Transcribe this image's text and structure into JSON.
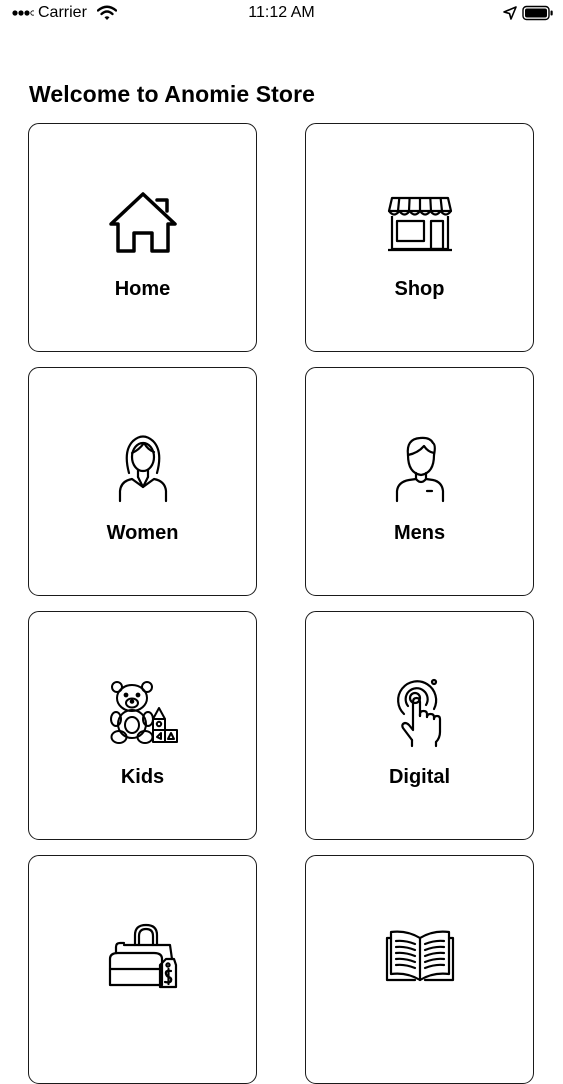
{
  "status_bar": {
    "carrier": "Carrier",
    "time": "11:12 AM",
    "signal_icon": "signal-dots-icon",
    "wifi_icon": "wifi-icon",
    "location_icon": "location-arrow-icon",
    "battery_icon": "battery-icon"
  },
  "page": {
    "title": "Welcome to Anomie Store"
  },
  "categories": [
    {
      "label": "Home",
      "icon": "house-icon"
    },
    {
      "label": "Shop",
      "icon": "storefront-icon"
    },
    {
      "label": "Women",
      "icon": "woman-avatar-icon"
    },
    {
      "label": "Mens",
      "icon": "man-avatar-icon"
    },
    {
      "label": "Kids",
      "icon": "teddy-bear-icon"
    },
    {
      "label": "Digital",
      "icon": "touch-target-icon"
    },
    {
      "label": "",
      "icon": "shopping-bags-icon"
    },
    {
      "label": "",
      "icon": "open-book-icon"
    }
  ],
  "colors": {
    "background": "#ffffff",
    "text": "#000000",
    "tile_border": "#1a1a1a"
  }
}
